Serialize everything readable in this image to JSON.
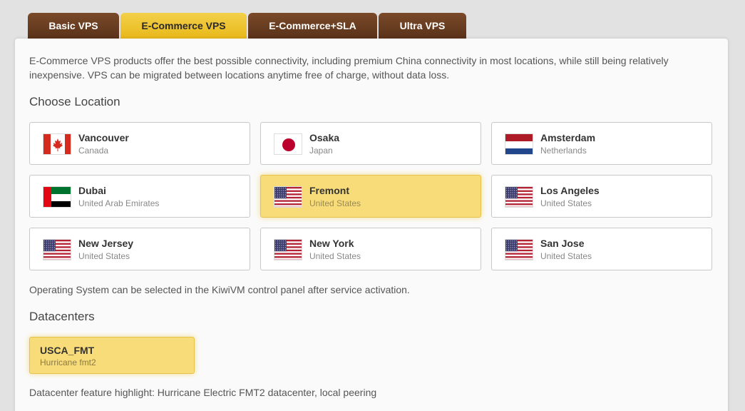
{
  "tabs": [
    {
      "label": "Basic VPS",
      "active": false
    },
    {
      "label": "E-Commerce VPS",
      "active": true
    },
    {
      "label": "E-Commerce+SLA",
      "active": false
    },
    {
      "label": "Ultra VPS",
      "active": false
    }
  ],
  "intro": "E-Commerce VPS products offer the best possible connectivity, including premium China connectivity in most locations, while still being relatively inexpensive. VPS can be migrated between locations anytime free of charge, without data loss.",
  "location_heading": "Choose Location",
  "locations": [
    {
      "city": "Vancouver",
      "country": "Canada",
      "flag": "canada-flag-icon",
      "selected": false
    },
    {
      "city": "Osaka",
      "country": "Japan",
      "flag": "japan-flag-icon",
      "selected": false
    },
    {
      "city": "Amsterdam",
      "country": "Netherlands",
      "flag": "netherlands-flag-icon",
      "selected": false
    },
    {
      "city": "Dubai",
      "country": "United Arab Emirates",
      "flag": "uae-flag-icon",
      "selected": false
    },
    {
      "city": "Fremont",
      "country": "United States",
      "flag": "usa-flag-icon",
      "selected": true
    },
    {
      "city": "Los Angeles",
      "country": "United States",
      "flag": "usa-flag-icon",
      "selected": false
    },
    {
      "city": "New Jersey",
      "country": "United States",
      "flag": "usa-flag-icon",
      "selected": false
    },
    {
      "city": "New York",
      "country": "United States",
      "flag": "usa-flag-icon",
      "selected": false
    },
    {
      "city": "San Jose",
      "country": "United States",
      "flag": "usa-flag-icon",
      "selected": false
    }
  ],
  "os_note": "Operating System can be selected in the KiwiVM control panel after service activation.",
  "datacenter_heading": "Datacenters",
  "datacenter": {
    "name": "USCA_FMT",
    "sub": "Hurricane fmt2",
    "selected": true
  },
  "datacenter_note": "Datacenter feature highlight: Hurricane Electric FMT2 datacenter, local peering",
  "colors": {
    "tab_brown": "#6b3d20",
    "tab_active_gold": "#eec12c",
    "selected_card": "#f8dc7a",
    "canada_red": "#d52b1e",
    "japan_red": "#bc002d",
    "nl_red": "#ae1c28",
    "nl_blue": "#21468b",
    "uae_green": "#00732f",
    "usa_red": "#b22234",
    "usa_blue": "#3c3b6e"
  }
}
